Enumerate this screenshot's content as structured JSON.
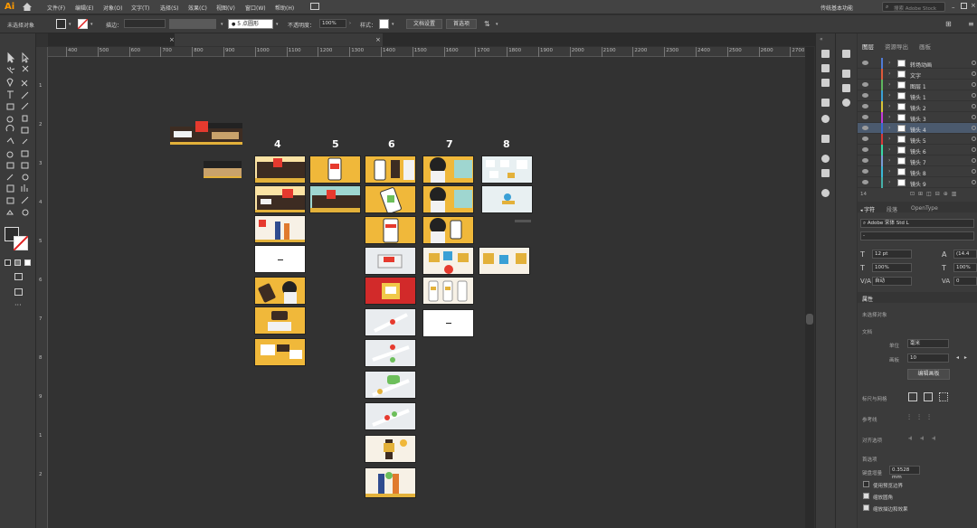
{
  "app": {
    "logo": "Ai"
  },
  "menu": [
    "文件(F)",
    "编辑(E)",
    "对象(O)",
    "文字(T)",
    "选择(S)",
    "效果(C)",
    "视图(V)",
    "窗口(W)",
    "帮助(H)"
  ],
  "workspace": {
    "name": "传统基本功能",
    "stock_search_placeholder": "搜索 Adobe Stock"
  },
  "control_bar": {
    "selection_label": "未选择对象",
    "stroke_label": "描边：",
    "brush_label": "5 点圆形",
    "opacity_label": "不透明度：",
    "opacity_value": "100%",
    "style_label": "样式：",
    "doc_setup": "文档设置",
    "prefs": "首选项"
  },
  "ruler": {
    "h_ticks": [
      "400",
      "500",
      "600",
      "700",
      "800",
      "900",
      "1000",
      "1100",
      "1200",
      "1300",
      "1400",
      "1500",
      "1600",
      "1700",
      "1800",
      "1900",
      "2000",
      "2100",
      "2200",
      "2300",
      "2400",
      "2500",
      "2600",
      "2700"
    ],
    "v_ticks": [
      "1",
      "2",
      "3",
      "4",
      "5",
      "6",
      "7",
      "8",
      "9",
      "1",
      "2"
    ]
  },
  "canvas": {
    "columns": [
      "4",
      "5",
      "6",
      "7",
      "8"
    ]
  },
  "layers_panel": {
    "tabs": [
      "图层",
      "资源导出",
      "画板"
    ],
    "layers": [
      {
        "name": "转场动画",
        "color": "#4f7bd6",
        "visible": true
      },
      {
        "name": "文字",
        "color": "#e05a3a",
        "visible": false
      },
      {
        "name": "图层 1",
        "color": "#5fb65f",
        "visible": true
      },
      {
        "name": "镜头 1",
        "color": "#3aa0d6",
        "visible": true
      },
      {
        "name": "镜头 2",
        "color": "#d6c43a",
        "visible": true
      },
      {
        "name": "镜头 3",
        "color": "#c43ad6",
        "visible": true
      },
      {
        "name": "镜头 4",
        "color": "#3a6ad6",
        "visible": true,
        "selected": true
      },
      {
        "name": "镜头 5",
        "color": "#d63a3a",
        "visible": true
      },
      {
        "name": "镜头 6",
        "color": "#3ad6a5",
        "visible": true
      },
      {
        "name": "镜头 7",
        "color": "#7a9cd6",
        "visible": true
      },
      {
        "name": "镜头 8",
        "color": "#3ab8d6",
        "visible": true
      },
      {
        "name": "镜头 9",
        "color": "#46b0a8",
        "visible": true
      }
    ],
    "count_label": "14"
  },
  "char_panel": {
    "tabs": [
      "字符",
      "段落",
      "OpenType"
    ],
    "font": "Adobe 宋体 Std L",
    "style": "-",
    "size": "12 pt",
    "leading": "(14.4",
    "h_scale": "100%",
    "v_scale": "100%",
    "tracking": "自动",
    "kerning": "0"
  },
  "properties": {
    "title": "属性",
    "no_selection": "未选择对象",
    "doc_label": "文档",
    "unit_label": "单位",
    "unit_value": "毫米",
    "artboard_label": "画板",
    "artboard_value": "10",
    "edit_artboard": "编辑画板",
    "rulers_grids": "标尺与网格",
    "guides": "参考线",
    "align_options": "对齐选项",
    "prefs_label": "首选项",
    "keyboard_inc": "键盘增量",
    "keyboard_value": "0.3528 mm",
    "preview_bounds": "使用预览边界",
    "scale_corners": "缩放圆角",
    "scale_strokes": "缩放描边和效果",
    "preview_bounds_checked": false,
    "scale_corners_checked": true,
    "scale_strokes_checked": true
  }
}
